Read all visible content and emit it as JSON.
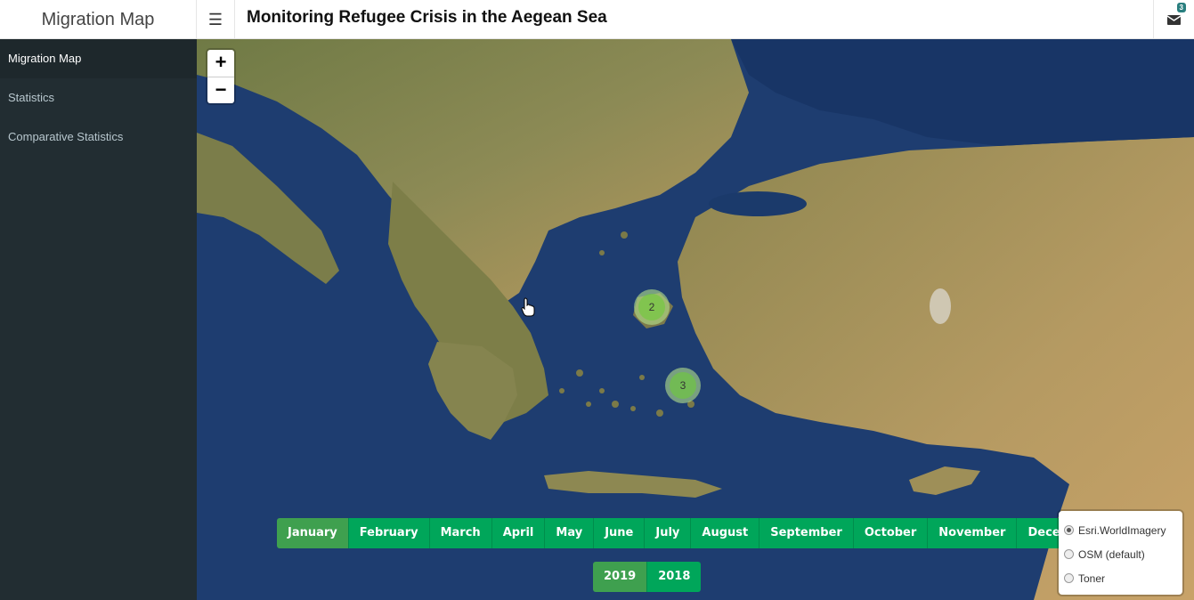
{
  "brand": "Migration Map",
  "menu_icon": "hamburger-icon",
  "title": "Monitoring Refugee Crisis in the Aegean Sea",
  "notifications": {
    "icon": "envelope-icon",
    "count": "3"
  },
  "sidebar": {
    "items": [
      {
        "label": "Migration Map",
        "active": true
      },
      {
        "label": "Statistics",
        "active": false
      },
      {
        "label": "Comparative Statistics",
        "active": false
      }
    ]
  },
  "map": {
    "zoom_in": "+",
    "zoom_out": "−",
    "clusters": [
      {
        "count": "2"
      },
      {
        "count": "3"
      }
    ],
    "months": [
      "January",
      "February",
      "March",
      "April",
      "May",
      "June",
      "July",
      "August",
      "September",
      "October",
      "November",
      "December"
    ],
    "active_month": "January",
    "years": [
      "2019",
      "2018"
    ],
    "active_year": "2019",
    "layers": [
      {
        "label": "Esri.WorldImagery",
        "checked": true
      },
      {
        "label": "OSM (default)",
        "checked": false
      },
      {
        "label": "Toner",
        "checked": false
      }
    ]
  },
  "colors": {
    "button_green": "#00a65a",
    "button_active": "#3fa04f",
    "sidebar_bg": "#222d32",
    "sea": "#1f3f72"
  }
}
